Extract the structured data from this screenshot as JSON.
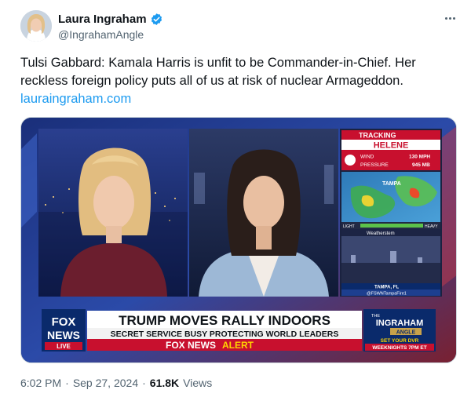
{
  "author": {
    "display_name": "Laura Ingraham",
    "handle": "@IngrahamAngle",
    "verified_color": "#1d9bf0"
  },
  "tweet": {
    "text": "Tulsi Gabbard: Kamala Harris is unfit to be Commander-in-Chief. Her reckless foreign policy puts all of us at risk of nuclear Armageddon.",
    "link": "lauraingraham.com"
  },
  "media": {
    "tracking_label": "TRACKING",
    "storm_name": "HELENE",
    "wind_label": "WIND",
    "wind_value": "130 MPH",
    "pressure_label": "PRESSURE",
    "pressure_value": "945 MB",
    "map_city": "TAMPA",
    "legend_light": "LIGHT",
    "legend_heavy": "HEAVY",
    "weatherstem": "Weatherstem",
    "cam_location": "TAMPA, FL",
    "cam_credit": "@FSWNTampaFire1",
    "network_logo_top": "FOX",
    "network_logo_bottom": "NEWS",
    "live_label": "LIVE",
    "headline": "TRUMP MOVES RALLY INDOORS",
    "subheadline": "SECRET SERVICE BUSY PROTECTING WORLD LEADERS",
    "alert_brand": "FOX NEWS",
    "alert_word": "ALERT",
    "show_the": "THE",
    "show_name": "INGRAHAM",
    "show_angle": "ANGLE",
    "dvr_line": "SET YOUR DVR",
    "time_line": "WEEKNIGHTS 7PM ET",
    "colors": {
      "fox_blue": "#0a2a6b",
      "alert_red": "#c8102e",
      "alert_yellow": "#ffd400"
    }
  },
  "meta": {
    "time": "6:02 PM",
    "separator": "·",
    "date": "Sep 27, 2024",
    "separator2": "·",
    "views_count": "61.8K",
    "views_label": "Views"
  },
  "icons": {
    "verified": "verified-badge-icon",
    "more": "more-horizontal-icon"
  }
}
